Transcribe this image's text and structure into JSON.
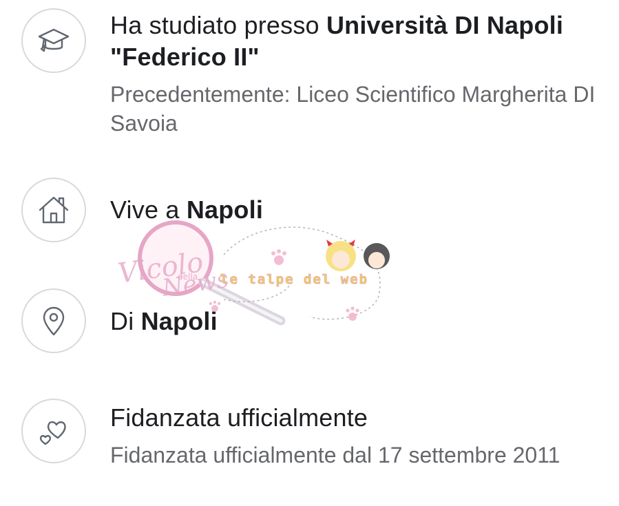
{
  "rows": [
    {
      "icon": "graduation-cap-icon",
      "primary_prefix": "Ha studiato presso ",
      "primary_bold": "Università DI Napoli \"Federico II\"",
      "secondary": "Precedentemente: Liceo Scientifico Margherita DI Savoia"
    },
    {
      "icon": "home-icon",
      "primary_prefix": "Vive a ",
      "primary_bold": "Napoli"
    },
    {
      "icon": "location-pin-icon",
      "primary_prefix": "Di ",
      "primary_bold": "Napoli"
    },
    {
      "icon": "hearts-icon",
      "primary_prefix": "Fidanzata ufficialmente",
      "secondary": "Fidanzata ufficialmente dal 17 settembre 2011"
    }
  ],
  "watermark": {
    "logo_text": "Vicolo della News",
    "tagline": "le talpe del web"
  },
  "colors": {
    "icon_stroke": "#606770",
    "circle_border": "#d6d9dd",
    "secondary_text": "#65676b",
    "watermark_pink": "#e6a6c6",
    "watermark_yellow": "#f2d14a"
  }
}
